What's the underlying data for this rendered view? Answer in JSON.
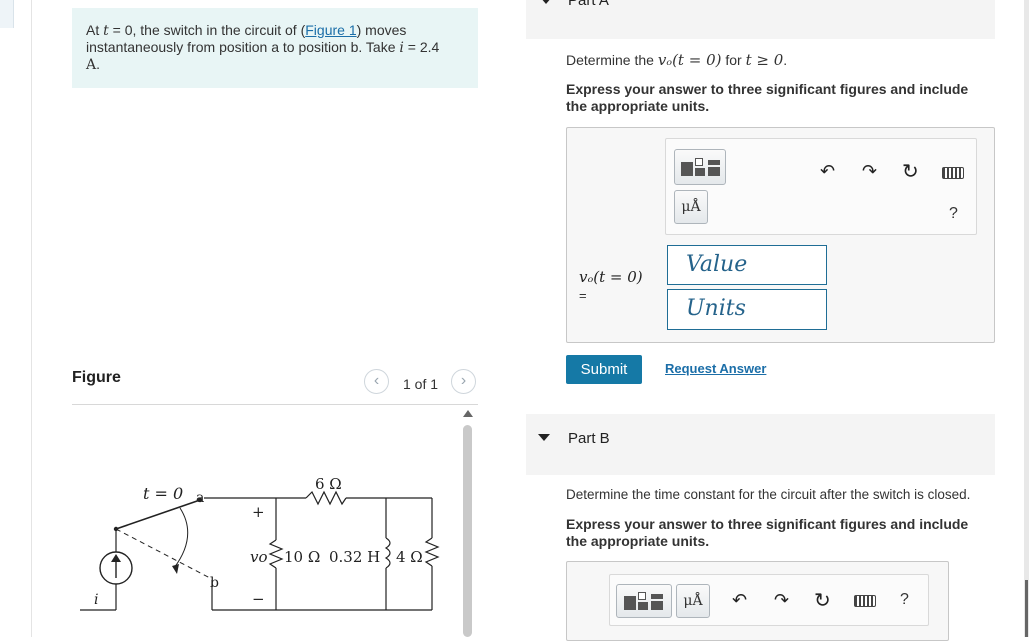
{
  "problem": {
    "prefix": "At ",
    "t_var": "t",
    "middle1": " = 0, the switch in the circuit of (",
    "figure_link": "Figure 1",
    "middle2": ") moves instantaneously from position a to position b. Take ",
    "i_var": "i",
    "value": " = 2.4",
    "unit": "A",
    "end": "."
  },
  "figure_panel": {
    "label": "Figure",
    "pager_text": "1 of 1",
    "prev_icon": "chevron-left-icon",
    "next_icon": "chevron-right-icon"
  },
  "circuit": {
    "switch_label": "t = 0",
    "node_a": "a",
    "node_b": "b",
    "plus": "+",
    "minus": "−",
    "vo_label": "vo",
    "r1": "10 Ω",
    "inductor": "0.32 H",
    "r2": "4 Ω",
    "r_series": "6 Ω",
    "source_label": "i"
  },
  "part_a": {
    "title": "Part A",
    "question_prefix": "Determine the ",
    "question_math": "vₒ(t = 0)",
    "question_mid": " for ",
    "question_math2": "t ≥ 0",
    "question_end": ".",
    "instruction": "Express your answer to three significant figures and include the appropriate units.",
    "answer_label": "vₒ(t = 0)",
    "equals": "=",
    "value_placeholder": "Value",
    "units_placeholder": "Units",
    "units_button": "μÅ",
    "help": "?",
    "submit": "Submit",
    "request_answer": "Request Answer"
  },
  "part_b": {
    "title": "Part B",
    "question": "Determine the time constant for the circuit after the switch is closed.",
    "instruction": "Express your answer to three significant figures and include the appropriate units.",
    "units_button": "μÅ",
    "help": "?"
  },
  "toolbar_icons": [
    "templates-icon",
    "units-icon",
    "undo-icon",
    "redo-icon",
    "reset-icon",
    "keyboard-icon",
    "help-icon"
  ]
}
